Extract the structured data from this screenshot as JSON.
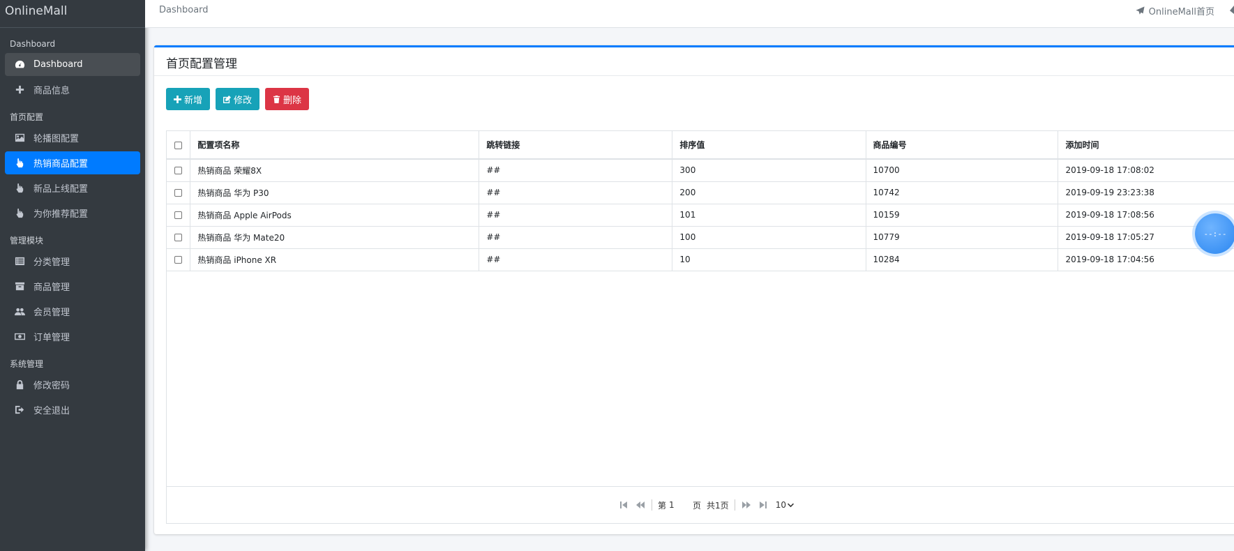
{
  "brand": "OnlineMall",
  "sidebar": {
    "sections": [
      {
        "header": "Dashboard",
        "items": [
          {
            "label": "Dashboard",
            "icon": "tachometer-icon",
            "state": "active-gray"
          },
          {
            "label": "商品信息",
            "icon": "plus-icon",
            "state": ""
          }
        ]
      },
      {
        "header": "首页配置",
        "items": [
          {
            "label": "轮播图配置",
            "icon": "image-icon",
            "state": ""
          },
          {
            "label": "热销商品配置",
            "icon": "hand-pointer-icon",
            "state": "active-blue"
          },
          {
            "label": "新品上线配置",
            "icon": "hand-pointer-icon",
            "state": ""
          },
          {
            "label": "为你推荐配置",
            "icon": "hand-pointer-icon",
            "state": ""
          }
        ]
      },
      {
        "header": "管理模块",
        "items": [
          {
            "label": "分类管理",
            "icon": "list-icon",
            "state": ""
          },
          {
            "label": "商品管理",
            "icon": "archive-icon",
            "state": ""
          },
          {
            "label": "会员管理",
            "icon": "users-icon",
            "state": ""
          },
          {
            "label": "订单管理",
            "icon": "money-icon",
            "state": ""
          }
        ]
      },
      {
        "header": "系统管理",
        "items": [
          {
            "label": "修改密码",
            "icon": "lock-icon",
            "state": ""
          },
          {
            "label": "安全退出",
            "icon": "sign-out-icon",
            "state": ""
          }
        ]
      }
    ]
  },
  "topbar": {
    "breadcrumb": "Dashboard",
    "home_link": "OnlineMall首页"
  },
  "card": {
    "title": "首页配置管理",
    "buttons": {
      "add": "新增",
      "edit": "修改",
      "delete": "删除"
    }
  },
  "table": {
    "columns": [
      "配置项名称",
      "跳转链接",
      "排序值",
      "商品编号",
      "添加时间"
    ],
    "rows": [
      [
        "热销商品 荣耀8X",
        "##",
        "300",
        "10700",
        "2019-09-18 17:08:02"
      ],
      [
        "热销商品 华为 P30",
        "##",
        "200",
        "10742",
        "2019-09-19 23:23:38"
      ],
      [
        "热销商品 Apple AirPods",
        "##",
        "101",
        "10159",
        "2019-09-18 17:08:56"
      ],
      [
        "热销商品 华为 Mate20",
        "##",
        "100",
        "10779",
        "2019-09-18 17:05:27"
      ],
      [
        "热销商品 iPhone XR",
        "##",
        "10",
        "10284",
        "2019-09-18 17:04:56"
      ]
    ]
  },
  "pager": {
    "page_prefix": "第",
    "page_value": "1",
    "page_suffix": "页",
    "total": "共1页",
    "page_size": "10"
  },
  "float_widget": "--:--"
}
